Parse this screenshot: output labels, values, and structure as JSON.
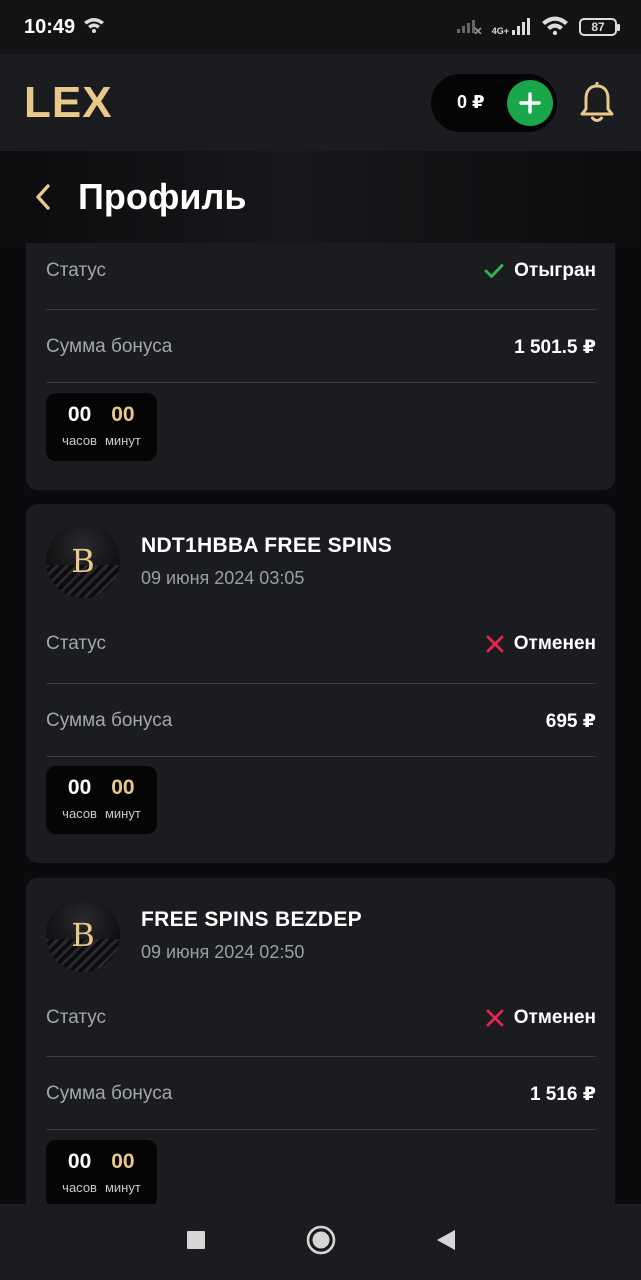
{
  "status_bar": {
    "time": "10:49",
    "network": "4G+",
    "battery": "87"
  },
  "header": {
    "logo": "LEX",
    "balance": "0 ₽"
  },
  "page": {
    "title": "Профиль"
  },
  "cards": [
    {
      "status_label": "Статус",
      "status_value": "Отыгран",
      "amount_label": "Сумма бонуса",
      "amount_value": "1 501.5 ₽",
      "timer": {
        "hours": "00",
        "hours_label": "часов",
        "minutes": "00",
        "minutes_label": "минут"
      }
    },
    {
      "avatar_letter": "B",
      "title": "NDT1HBBA FREE SPINS",
      "date": "09 июня 2024 03:05",
      "status_label": "Статус",
      "status_value": "Отменен",
      "amount_label": "Сумма бонуса",
      "amount_value": "695 ₽",
      "timer": {
        "hours": "00",
        "hours_label": "часов",
        "minutes": "00",
        "minutes_label": "минут"
      }
    },
    {
      "avatar_letter": "B",
      "title": "FREE SPINS BEZDEP",
      "date": "09 июня 2024 02:50",
      "status_label": "Статус",
      "status_value": "Отменен",
      "amount_label": "Сумма бонуса",
      "amount_value": "1 516 ₽",
      "timer": {
        "hours": "00",
        "hours_label": "часов",
        "minutes": "00",
        "minutes_label": "минут"
      }
    }
  ],
  "colors": {
    "accent_gold": "#e8c98a",
    "success": "#2fb84d",
    "danger": "#e5264a",
    "add_button": "#1aa64a"
  },
  "icons": [
    "wifi-icon",
    "signal-icon",
    "battery-icon",
    "plus-icon",
    "bell-icon",
    "back-chevron-icon",
    "check-icon",
    "cross-icon",
    "nav-square-icon",
    "nav-circle-icon",
    "nav-triangle-icon"
  ]
}
